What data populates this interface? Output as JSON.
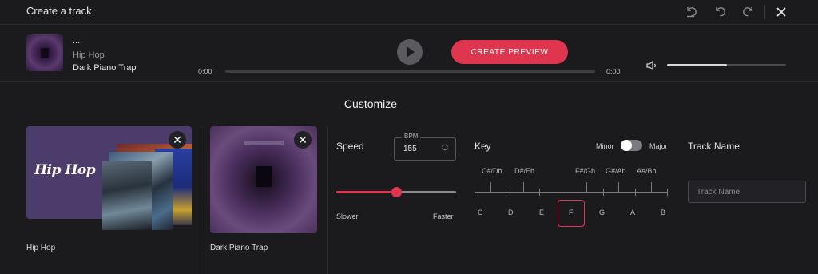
{
  "header": {
    "title": "Create a track",
    "icons": [
      "history-icon",
      "undo-icon",
      "redo-icon",
      "close-icon"
    ]
  },
  "player": {
    "dots": "...",
    "genre": "Hip Hop",
    "track": "Dark Piano Trap",
    "create_label": "CREATE PREVIEW",
    "time_start": "0:00",
    "time_end": "0:00",
    "progress": 0,
    "volume": 0.5
  },
  "customize": {
    "title": "Customize",
    "cards": [
      {
        "label": "Hip Hop",
        "logo": "Hip Hop"
      },
      {
        "label": "Dark Piano Trap"
      }
    ],
    "speed": {
      "label": "Speed",
      "bpm_caption": "BPM",
      "bpm": "155",
      "position": 0.5,
      "slower": "Slower",
      "faster": "Faster"
    },
    "key": {
      "label": "Key",
      "minor": "Minor",
      "major": "Major",
      "mode": "Minor",
      "sharps": [
        "C#/Db",
        "D#/Eb",
        "F#/Gb",
        "G#/Ab",
        "A#/Bb"
      ],
      "naturals": [
        "C",
        "D",
        "E",
        "F",
        "G",
        "A",
        "B"
      ],
      "selected": "F"
    },
    "track_name": {
      "label": "Track Name",
      "placeholder": "Track Name",
      "value": ""
    }
  },
  "colors": {
    "accent": "#e0354f",
    "background": "#1b1b1e",
    "card_purple": "#4c3c6b"
  }
}
